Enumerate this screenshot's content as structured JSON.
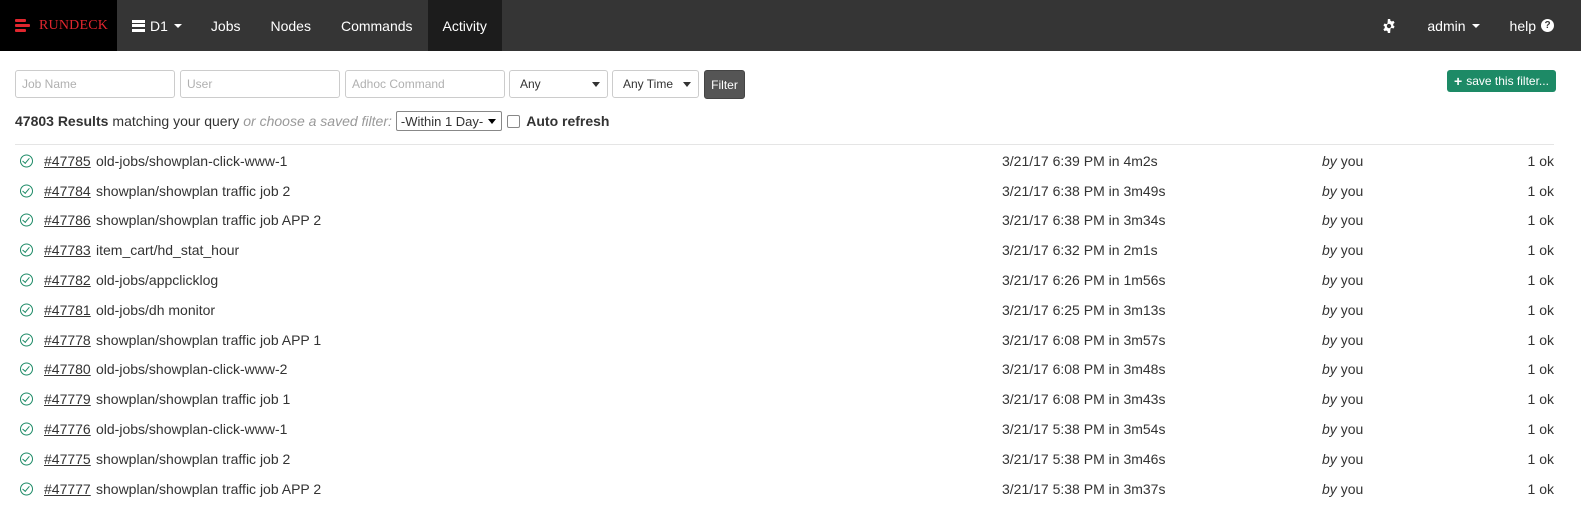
{
  "brand": {
    "name": "RUNDECK"
  },
  "nav": {
    "project": "D1",
    "items": [
      {
        "label": "Jobs"
      },
      {
        "label": "Nodes"
      },
      {
        "label": "Commands"
      },
      {
        "label": "Activity",
        "active": true
      }
    ],
    "user": "admin",
    "help": "help"
  },
  "filters": {
    "job_name_placeholder": "Job Name",
    "user_placeholder": "User",
    "adhoc_placeholder": "Adhoc Command",
    "status_value": "Any",
    "time_value": "Any Time",
    "filter_button": "Filter",
    "save_button": "save this filter..."
  },
  "results": {
    "count": "47803 Results",
    "matching_text": "matching your query",
    "saved_filter_text": "or choose a saved filter:",
    "saved_filter_value": "-Within 1 Day-",
    "auto_refresh_label": "Auto refresh"
  },
  "executions": [
    {
      "id": "#47785",
      "job": "old-jobs/showplan-click-www-1",
      "time": "3/21/17 6:39 PM",
      "in_label": "in",
      "duration": "4m2s",
      "by_label": "by",
      "user": "you",
      "nodes": "1 ok"
    },
    {
      "id": "#47784",
      "job": "showplan/showplan traffic job 2",
      "time": "3/21/17 6:38 PM",
      "in_label": "in",
      "duration": "3m49s",
      "by_label": "by",
      "user": "you",
      "nodes": "1 ok"
    },
    {
      "id": "#47786",
      "job": "showplan/showplan traffic job APP 2",
      "time": "3/21/17 6:38 PM",
      "in_label": "in",
      "duration": "3m34s",
      "by_label": "by",
      "user": "you",
      "nodes": "1 ok"
    },
    {
      "id": "#47783",
      "job": "item_cart/hd_stat_hour",
      "time": "3/21/17 6:32 PM",
      "in_label": "in",
      "duration": "2m1s",
      "by_label": "by",
      "user": "you",
      "nodes": "1 ok"
    },
    {
      "id": "#47782",
      "job": "old-jobs/appclicklog",
      "time": "3/21/17 6:26 PM",
      "in_label": "in",
      "duration": "1m56s",
      "by_label": "by",
      "user": "you",
      "nodes": "1 ok"
    },
    {
      "id": "#47781",
      "job": "old-jobs/dh monitor",
      "time": "3/21/17 6:25 PM",
      "in_label": "in",
      "duration": "3m13s",
      "by_label": "by",
      "user": "you",
      "nodes": "1 ok"
    },
    {
      "id": "#47778",
      "job": "showplan/showplan traffic job APP 1",
      "time": "3/21/17 6:08 PM",
      "in_label": "in",
      "duration": "3m57s",
      "by_label": "by",
      "user": "you",
      "nodes": "1 ok"
    },
    {
      "id": "#47780",
      "job": "old-jobs/showplan-click-www-2",
      "time": "3/21/17 6:08 PM",
      "in_label": "in",
      "duration": "3m48s",
      "by_label": "by",
      "user": "you",
      "nodes": "1 ok"
    },
    {
      "id": "#47779",
      "job": "showplan/showplan traffic job 1",
      "time": "3/21/17 6:08 PM",
      "in_label": "in",
      "duration": "3m43s",
      "by_label": "by",
      "user": "you",
      "nodes": "1 ok"
    },
    {
      "id": "#47776",
      "job": "old-jobs/showplan-click-www-1",
      "time": "3/21/17 5:38 PM",
      "in_label": "in",
      "duration": "3m54s",
      "by_label": "by",
      "user": "you",
      "nodes": "1 ok"
    },
    {
      "id": "#47775",
      "job": "showplan/showplan traffic job 2",
      "time": "3/21/17 5:38 PM",
      "in_label": "in",
      "duration": "3m46s",
      "by_label": "by",
      "user": "you",
      "nodes": "1 ok"
    },
    {
      "id": "#47777",
      "job": "showplan/showplan traffic job APP 2",
      "time": "3/21/17 5:38 PM",
      "in_label": "in",
      "duration": "3m37s",
      "by_label": "by",
      "user": "you",
      "nodes": "1 ok"
    }
  ],
  "colors": {
    "navbar": "#353535",
    "brand_red": "#e0262e",
    "success_green": "#1d8a66",
    "filter_button": "#555555"
  },
  "icons": {
    "brand": "rundeck-logo-icon",
    "project": "database-icon",
    "settings": "gear-icon",
    "help": "question-circle-icon",
    "save": "plus-icon",
    "status": "check-circle-icon"
  }
}
